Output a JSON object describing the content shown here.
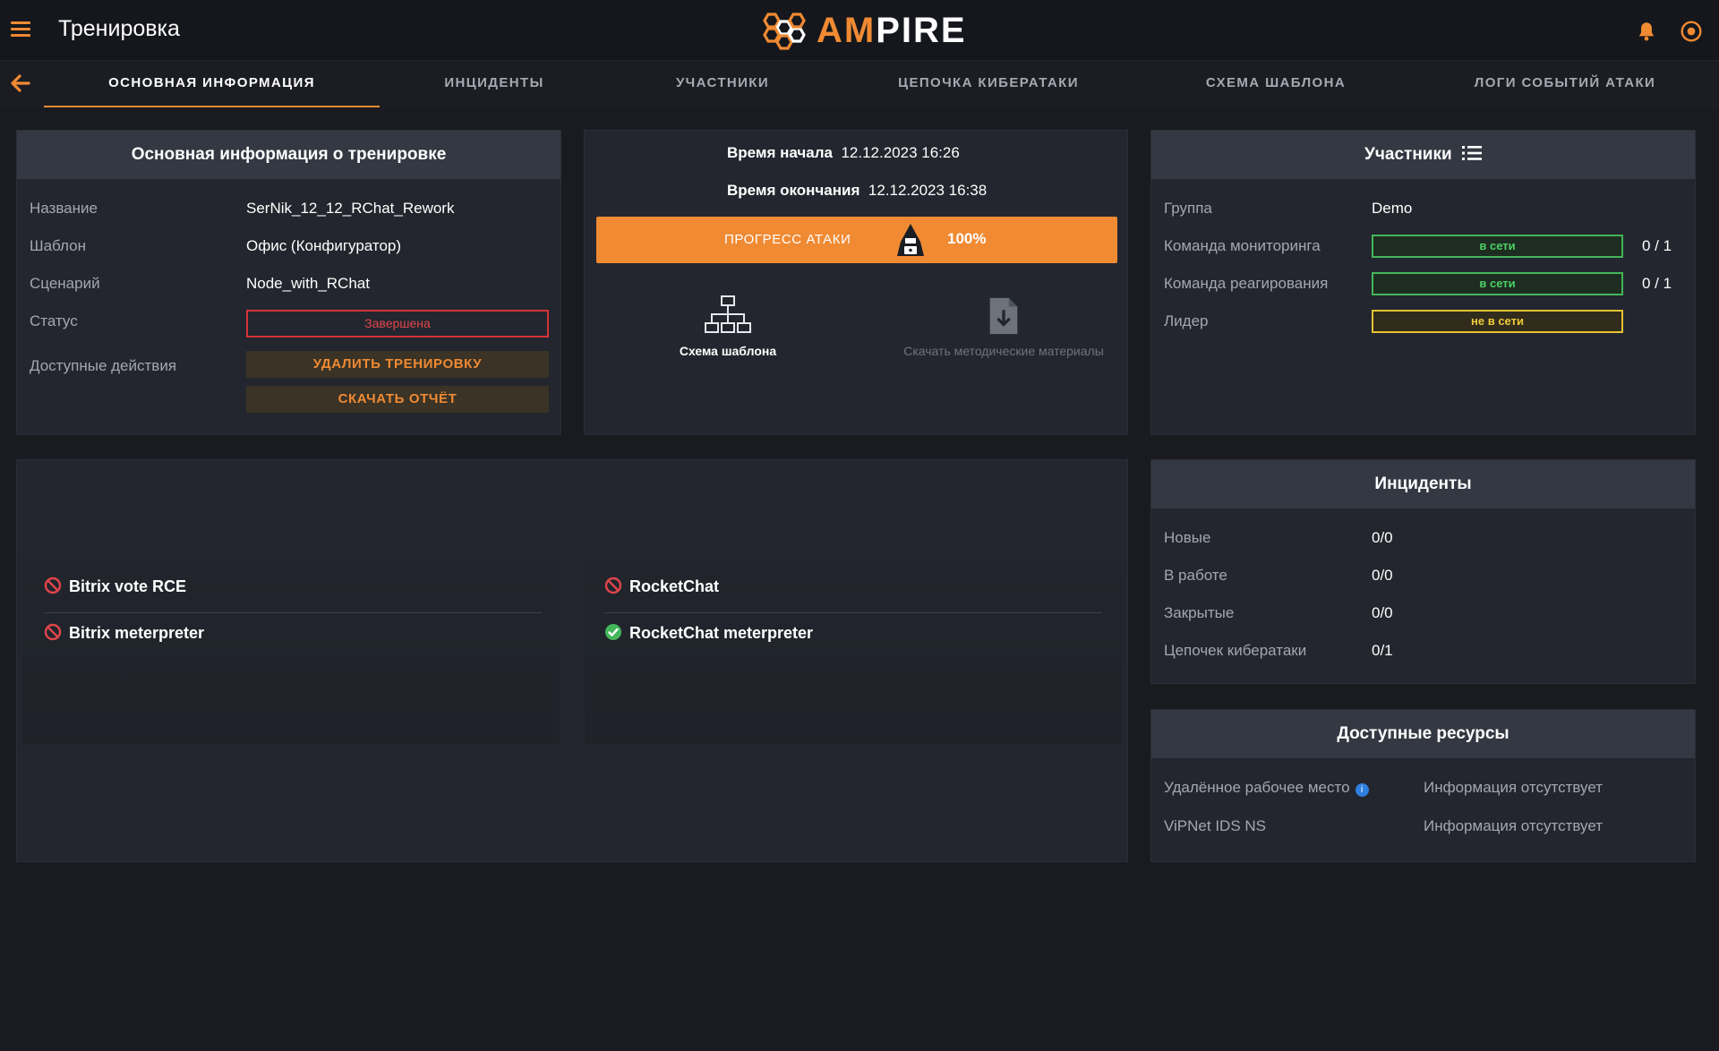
{
  "header": {
    "title": "Тренировка",
    "logo_part1": "AM",
    "logo_part2": "PIRE"
  },
  "tabs": [
    {
      "label": "ОСНОВНАЯ ИНФОРМАЦИЯ",
      "active": true
    },
    {
      "label": "ИНЦИДЕНТЫ",
      "active": false
    },
    {
      "label": "УЧАСТНИКИ",
      "active": false
    },
    {
      "label": "ЦЕПОЧКА КИБЕРАТАКИ",
      "active": false
    },
    {
      "label": "СХЕМА ШАБЛОНА",
      "active": false
    },
    {
      "label": "ЛОГИ СОБЫТИЙ АТАКИ",
      "active": false
    }
  ],
  "main_info": {
    "title": "Основная информация о тренировке",
    "rows": [
      {
        "label": "Название",
        "value": "SerNik_12_12_RChat_Rework"
      },
      {
        "label": "Шаблон",
        "value": "Офис (Конфигуратор)"
      },
      {
        "label": "Сценарий",
        "value": "Node_with_RChat"
      }
    ],
    "status_label": "Статус",
    "status_value": "Завершена",
    "actions_label": "Доступные действия",
    "delete_button": "УДАЛИТЬ ТРЕНИРОВКУ",
    "download_report_button": "СКАЧАТЬ ОТЧЁТ"
  },
  "timing": {
    "start_label": "Время начала",
    "start_value": "12.12.2023 16:26",
    "end_label": "Время окончания",
    "end_value": "12.12.2023 16:38",
    "progress_label": "ПРОГРЕСС АТАКИ",
    "progress_value": "100%",
    "progress_fraction": 1.0,
    "scheme_tile": "Схема шаблона",
    "materials_tile": "Скачать методические материалы"
  },
  "participants": {
    "title": "Участники",
    "group_label": "Группа",
    "group_value": "Demo",
    "teams": [
      {
        "label": "Команда мониторинга",
        "status": "в сети",
        "online": true,
        "count": "0 / 1"
      },
      {
        "label": "Команда реагирования",
        "status": "в сети",
        "online": true,
        "count": "0 / 1"
      },
      {
        "label": "Лидер",
        "status": "не в сети",
        "online": false,
        "count": ""
      }
    ]
  },
  "incidents": {
    "title": "Инциденты",
    "rows": [
      {
        "label": "Новые",
        "value": "0/0"
      },
      {
        "label": "В работе",
        "value": "0/0"
      },
      {
        "label": "Закрытые",
        "value": "0/0"
      },
      {
        "label": "Цепочек кибератаки",
        "value": "0/1"
      }
    ]
  },
  "resources": {
    "title": "Доступные ресурсы",
    "rows": [
      {
        "label": "Удалённое рабочее место",
        "value": "Информация отсутствует",
        "info": true
      },
      {
        "label": "ViPNet IDS NS",
        "value": "Информация отсутствует",
        "info": false
      }
    ]
  },
  "attack_chains": [
    {
      "steps": [
        {
          "name": "Bitrix vote RCE",
          "status": "blocked"
        },
        {
          "name": "Bitrix meterpreter",
          "status": "blocked"
        }
      ]
    },
    {
      "steps": [
        {
          "name": "RocketChat",
          "status": "blocked"
        },
        {
          "name": "RocketChat meterpreter",
          "status": "success"
        }
      ]
    }
  ],
  "colors": {
    "accent": "#f08a33",
    "background": "#191b21",
    "panel": "#23262e",
    "panel_header": "#343842",
    "online": "#43b65a",
    "offline": "#e6c233",
    "danger": "#d4333a"
  }
}
